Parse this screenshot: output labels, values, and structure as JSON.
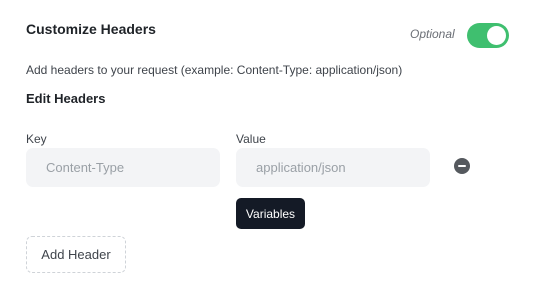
{
  "header": {
    "title": "Customize Headers",
    "optional_label": "Optional",
    "toggle_on": true,
    "toggle_color": "#3fbf6f"
  },
  "description": "Add headers to your request (example: Content-Type: application/json)",
  "section_title": "Edit Headers",
  "columns": {
    "key_label": "Key",
    "value_label": "Value"
  },
  "rows": [
    {
      "key_value": "",
      "key_placeholder": "Content-Type",
      "value_value": "",
      "value_placeholder": "application/json"
    }
  ],
  "buttons": {
    "variables_label": "Variables",
    "add_header_label": "Add Header"
  },
  "icons": {
    "remove": "minus-circle-icon"
  }
}
